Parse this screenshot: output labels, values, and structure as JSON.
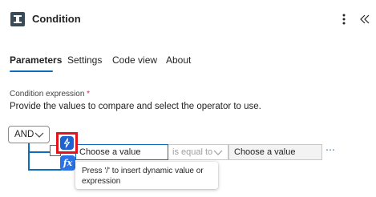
{
  "header": {
    "title": "Condition",
    "more_icon": "more-vertical-icon",
    "collapse_icon": "double-chevron-left-icon"
  },
  "tabs": [
    {
      "label": "Parameters",
      "active": true
    },
    {
      "label": "Settings",
      "active": false
    },
    {
      "label": "Code view",
      "active": false
    },
    {
      "label": "About",
      "active": false
    }
  ],
  "condition": {
    "label": "Condition expression",
    "required_mark": "*",
    "description": "Provide the values to compare and select the operator to use.",
    "group_operator": "AND",
    "row": {
      "left_placeholder": "Choose a value",
      "operator": "is equal to",
      "right_placeholder": "Choose a value",
      "more_label": "⋯"
    },
    "dynamic_button_icon": "lightning-icon",
    "expression_button_label": "fx",
    "tooltip": "Press '/' to insert dynamic value or expression"
  },
  "colors": {
    "accent": "#0f6cbd",
    "highlight": "#e3141c",
    "dynamic_button": "#1f62d1"
  }
}
